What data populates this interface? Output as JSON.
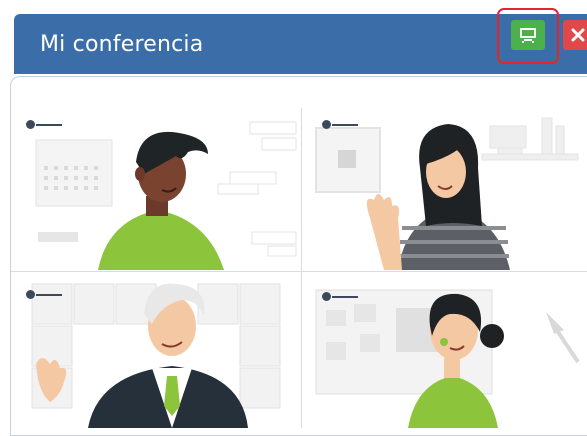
{
  "window": {
    "title": "Mi conferencia",
    "buttons": {
      "expand_icon": "monitor-icon",
      "close_icon": "close-icon"
    },
    "accent": "#3b6ea8",
    "highlight_color": "#e5242b"
  },
  "participants": [
    {
      "illustration": "man-dark-hair-green-shirt"
    },
    {
      "illustration": "woman-long-hair-striped-shirt"
    },
    {
      "illustration": "older-man-suit-tie"
    },
    {
      "illustration": "woman-bun-green-shirt"
    }
  ]
}
